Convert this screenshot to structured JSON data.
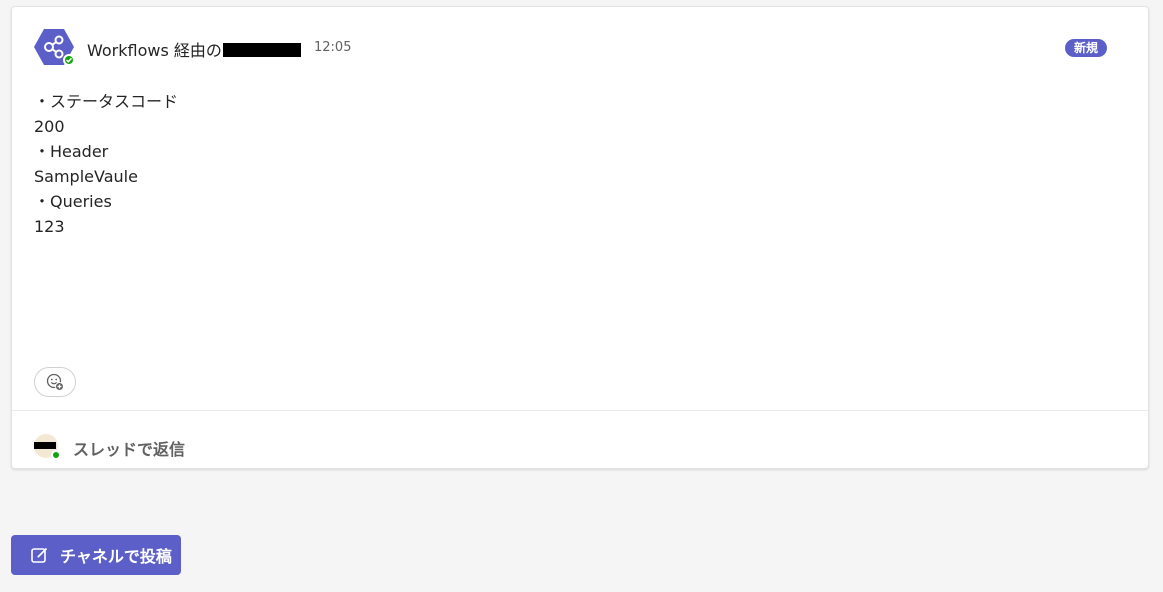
{
  "message": {
    "sender_prefix": "Workflows 経由の",
    "time": "12:05",
    "badge": "新規",
    "lines": [
      "・ステータスコード",
      "200",
      "",
      "・Header",
      "SampleVaule",
      "",
      "・Queries",
      "123"
    ]
  },
  "reply": {
    "label": "スレッドで返信"
  },
  "compose": {
    "label": "チャネルで投稿"
  },
  "colors": {
    "accent": "#5b5fc7",
    "status_online": "#13a10e"
  },
  "icons": {
    "bot": "workflow-share-icon",
    "reaction": "add-reaction-icon",
    "compose": "compose-edit-icon"
  }
}
